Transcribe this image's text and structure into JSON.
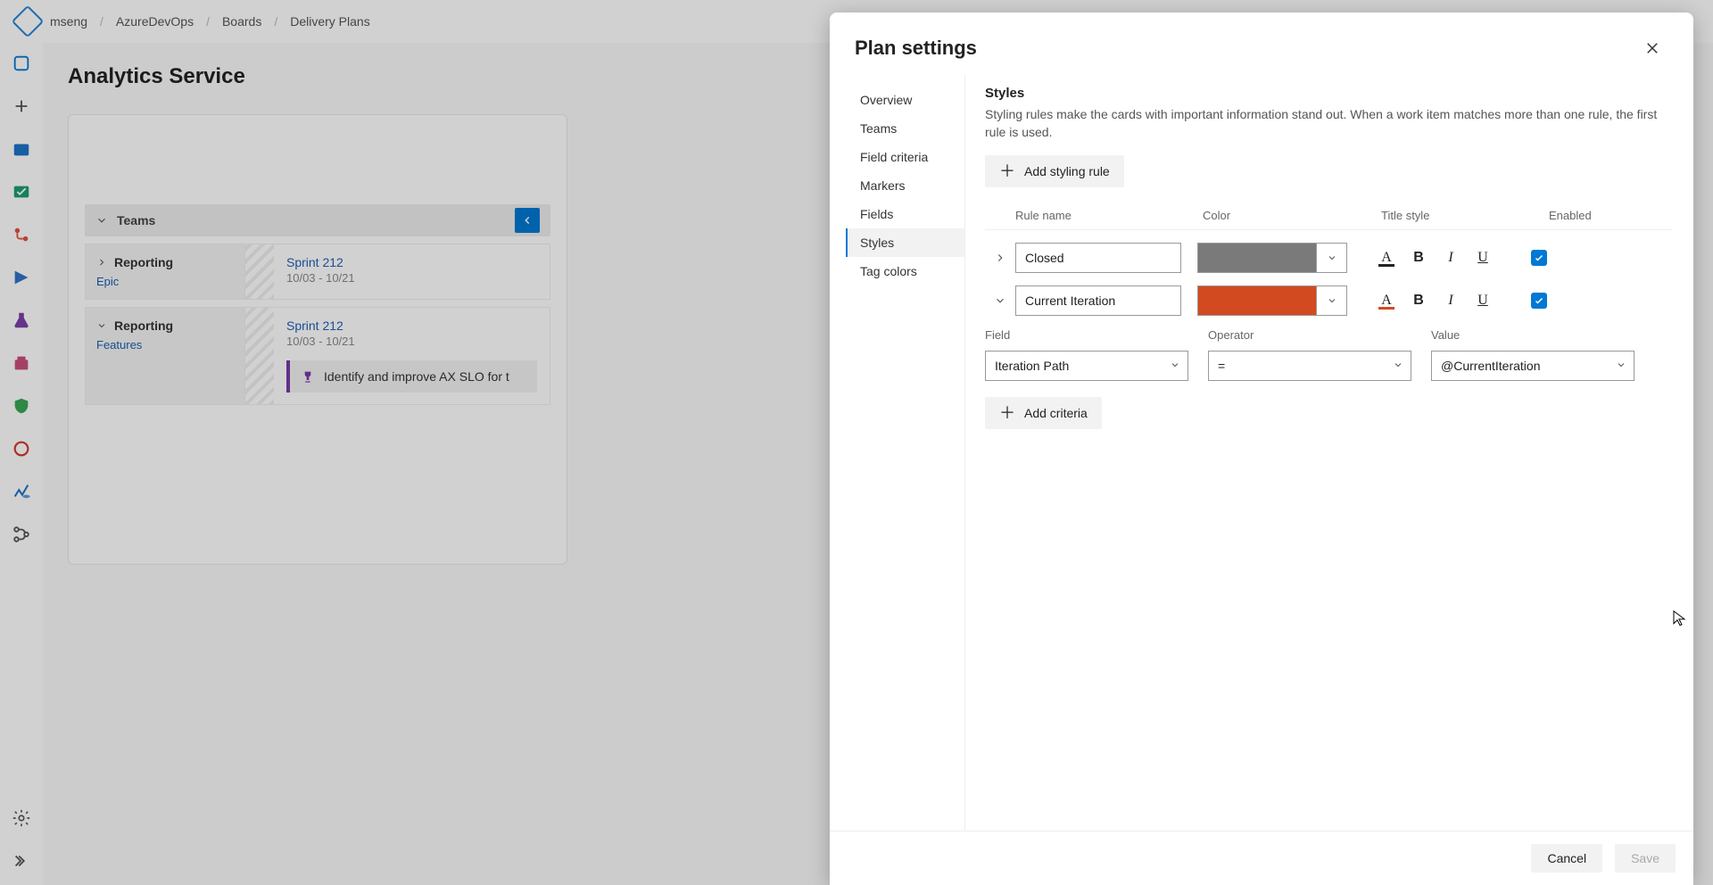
{
  "breadcrumb": {
    "items": [
      "mseng",
      "AzureDevOps",
      "Boards",
      "Delivery Plans"
    ]
  },
  "page": {
    "title": "Analytics Service"
  },
  "plan": {
    "teams_label": "Teams",
    "lanes": [
      {
        "name": "Reporting",
        "type": "Epic",
        "sprint": "Sprint 212",
        "dates": "10/03 - 10/21",
        "card": null
      },
      {
        "name": "Reporting",
        "type": "Features",
        "sprint": "Sprint 212",
        "dates": "10/03 - 10/21",
        "card": "Identify and improve AX SLO for t"
      }
    ]
  },
  "panel": {
    "title": "Plan settings",
    "nav": [
      "Overview",
      "Teams",
      "Field criteria",
      "Markers",
      "Fields",
      "Styles",
      "Tag colors"
    ],
    "nav_active": "Styles",
    "styles": {
      "heading": "Styles",
      "description": "Styling rules make the cards with important information stand out. When a work item matches more than one rule, the first rule is used.",
      "add_button": "Add styling rule",
      "columns": {
        "rule": "Rule name",
        "color": "Color",
        "title_style": "Title style",
        "enabled": "Enabled"
      },
      "rules": [
        {
          "expanded": false,
          "name": "Closed",
          "color": "#7a7a7a",
          "fontbar": "#222",
          "enabled": true
        },
        {
          "expanded": true,
          "name": "Current Iteration",
          "color": "#d24a1f",
          "fontbar": "#d24a1f",
          "enabled": true
        }
      ],
      "criteria_labels": {
        "field": "Field",
        "operator": "Operator",
        "value": "Value"
      },
      "criteria": {
        "field": "Iteration Path",
        "operator": "=",
        "value": "@CurrentIteration"
      },
      "add_criteria": "Add criteria"
    },
    "footer": {
      "cancel": "Cancel",
      "save": "Save"
    }
  }
}
